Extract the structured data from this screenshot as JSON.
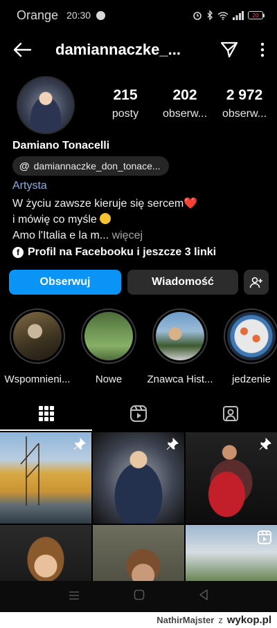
{
  "status_bar": {
    "carrier": "Orange",
    "time": "20:30",
    "battery": "20",
    "battery_color": "#ff4a4a"
  },
  "header": {
    "username": "damiannaczke_...",
    "icons": [
      "back-arrow-icon",
      "send-icon",
      "more-vertical-icon"
    ]
  },
  "profile": {
    "stats": [
      {
        "value": "215",
        "label": "posty"
      },
      {
        "value": "202",
        "label": "obserw..."
      },
      {
        "value": "2 972",
        "label": "obserw..."
      }
    ],
    "name": "Damiano Tonacelli",
    "threads_handle": "damiannaczke_don_tonace...",
    "category": "Artysta",
    "bio_line1": "W życiu zawsze kieruje się sercem",
    "bio_line1_emoji": "❤️",
    "bio_line2": "i mówię co myśle",
    "bio_line3": "Amo l'Italia e la m...",
    "bio_more": "więcej",
    "links_label": "Profil na Facebooku i jeszcze 3 linki"
  },
  "actions": {
    "follow": "Obserwuj",
    "message": "Wiadomość",
    "follow_color": "#0a95f6"
  },
  "highlights": [
    {
      "label": "Wspomnieni..."
    },
    {
      "label": "Nowe"
    },
    {
      "label": "Znawca Hist..."
    },
    {
      "label": "jedzenie"
    }
  ],
  "tabs": [
    "grid-icon",
    "reels-icon",
    "tagged-icon"
  ],
  "grid": {
    "posts": [
      {
        "kind": "harbor photo",
        "pinned": true
      },
      {
        "kind": "portrait photo",
        "pinned": true
      },
      {
        "kind": "guitar concert photo",
        "pinned": true
      },
      {
        "kind": "studio portrait",
        "pinned": false
      },
      {
        "kind": "sunglasses portrait",
        "pinned": false
      },
      {
        "kind": "outdoor event video",
        "pinned": false,
        "reel": true
      }
    ]
  },
  "watermark": {
    "user": "NathirMajster",
    "sep": "z",
    "site": "wykop.pl"
  }
}
